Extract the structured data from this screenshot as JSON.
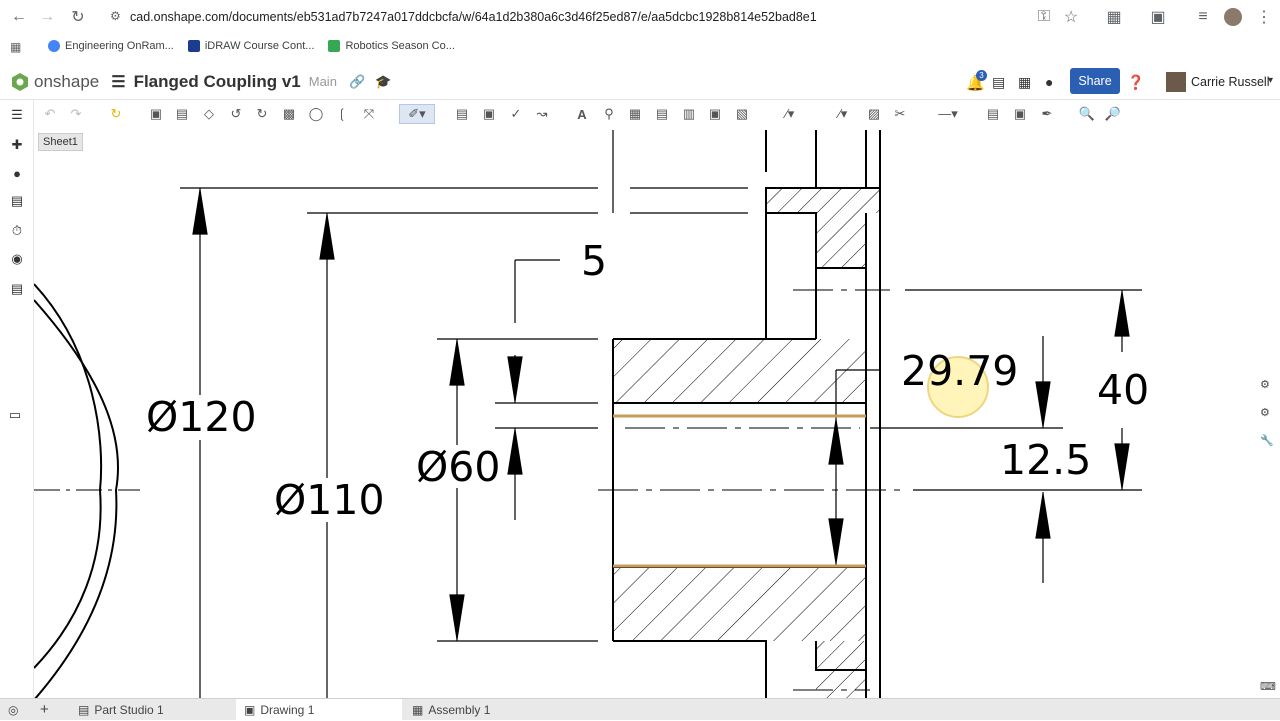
{
  "browser": {
    "url": "cad.onshape.com/documents/eb531ad7b7247a017ddcbcfa/w/64a1d2b380a6c3d46f25ed87/e/aa5dcbc1928b814e52bad8e1",
    "bookmarks": [
      {
        "label": "Engineering OnRam...",
        "color": "#4285f4"
      },
      {
        "label": "iDRAW Course Cont...",
        "color": "#1a3d8f"
      },
      {
        "label": "Robotics Season Co...",
        "color": "#34a853"
      }
    ]
  },
  "app": {
    "logo": "onshape",
    "document_title": "Flanged Coupling v1",
    "branch": "Main",
    "notifications_count": "3",
    "share_label": "Share",
    "user_name": "Carrie Russell",
    "brand_color": "#2b5fb4"
  },
  "sheet": {
    "label": "Sheet1"
  },
  "drawing": {
    "dims": {
      "d120": "Ø120",
      "d110": "Ø110",
      "d60": "Ø60",
      "five": "5",
      "v2979": "29.79",
      "forty": "40",
      "v125": "12.5"
    }
  },
  "tabs": [
    {
      "label": "Part Studio 1",
      "icon": "part-studio-icon",
      "active": false
    },
    {
      "label": "Drawing 1",
      "icon": "drawing-icon",
      "active": true
    },
    {
      "label": "Assembly 1",
      "icon": "assembly-icon",
      "active": false
    }
  ]
}
